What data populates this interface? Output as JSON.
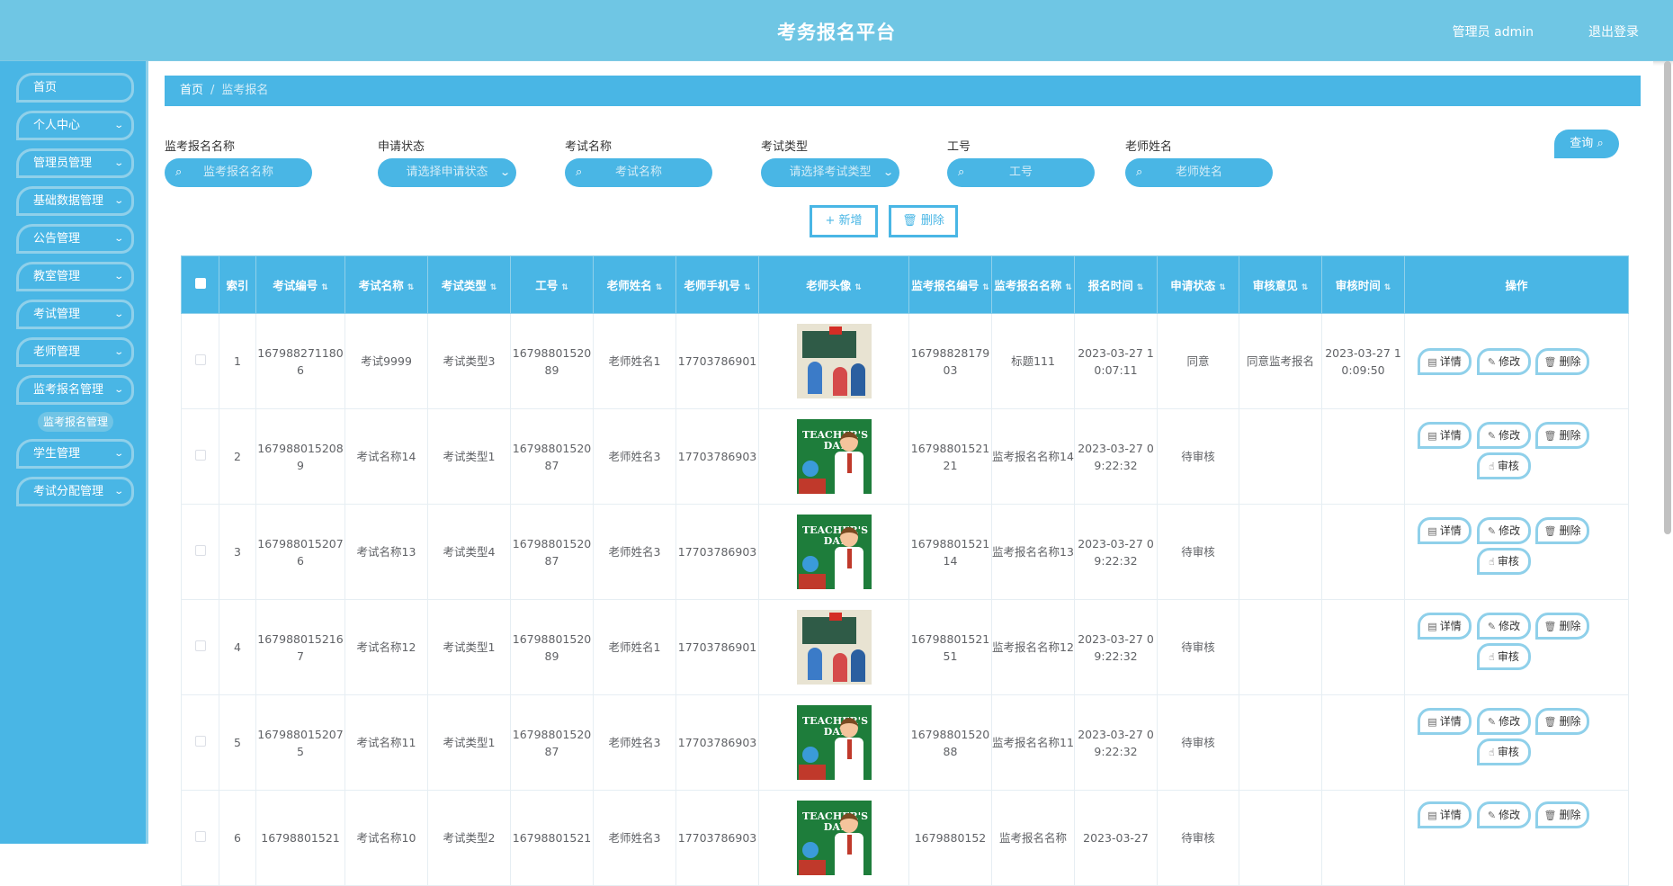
{
  "header": {
    "title": "考务报名平台",
    "user": "管理员 admin",
    "logout": "退出登录"
  },
  "sidebar": {
    "items": [
      {
        "label": "首页",
        "chevron": false
      },
      {
        "label": "个人中心",
        "chevron": true
      },
      {
        "label": "管理员管理",
        "chevron": true
      },
      {
        "label": "基础数据管理",
        "chevron": true
      },
      {
        "label": "公告管理",
        "chevron": true
      },
      {
        "label": "教室管理",
        "chevron": true
      },
      {
        "label": "考试管理",
        "chevron": true
      },
      {
        "label": "老师管理",
        "chevron": true
      },
      {
        "label": "监考报名管理",
        "chevron": true
      }
    ],
    "active_sub": "监考报名管理",
    "items_after": [
      {
        "label": "学生管理"
      },
      {
        "label": "考试分配管理"
      }
    ]
  },
  "breadcrumb": {
    "home": "首页",
    "sep": "/",
    "current": "监考报名"
  },
  "filters": [
    {
      "label": "监考报名名称",
      "placeholder": "监考报名名称"
    },
    {
      "label": "申请状态",
      "placeholder": "请选择申请状态"
    },
    {
      "label": "考试名称",
      "placeholder": "考试名称"
    },
    {
      "label": "考试类型",
      "placeholder": "请选择考试类型"
    },
    {
      "label": "工号",
      "placeholder": "工号"
    },
    {
      "label": "老师姓名",
      "placeholder": "老师姓名"
    }
  ],
  "query_btn": "查询",
  "add_btn": "+ 新增",
  "del_btn": "删除",
  "table": {
    "headers": [
      "索引",
      "考试编号",
      "考试名称",
      "考试类型",
      "工号",
      "老师姓名",
      "老师手机号",
      "老师头像",
      "监考报名编号",
      "监考报名名称",
      "报名时间",
      "申请状态",
      "审核意见",
      "审核时间",
      "操作"
    ],
    "rows": [
      {
        "idx": "1",
        "exam_no": "1679882711806",
        "exam_name": "考试9999",
        "exam_type": "考试类型3",
        "job_no": "1679880152089",
        "teacher": "老师姓名1",
        "phone": "17703786901",
        "avatar": "classroom",
        "reg_no": "1679882817903",
        "reg_name": "标题111",
        "reg_time": "2023-03-27 10:07:11",
        "status": "同意",
        "opinion": "同意监考报名",
        "audit_time": "2023-03-27 10:09:50"
      },
      {
        "idx": "2",
        "exam_no": "1679880152089",
        "exam_name": "考试名称14",
        "exam_type": "考试类型1",
        "job_no": "1679880152087",
        "teacher": "老师姓名3",
        "phone": "17703786903",
        "avatar": "teacher",
        "reg_no": "1679880152121",
        "reg_name": "监考报名名称14",
        "reg_time": "2023-03-27 09:22:32",
        "status": "待审核",
        "opinion": "",
        "audit_time": ""
      },
      {
        "idx": "3",
        "exam_no": "1679880152076",
        "exam_name": "考试名称13",
        "exam_type": "考试类型4",
        "job_no": "1679880152087",
        "teacher": "老师姓名3",
        "phone": "17703786903",
        "avatar": "teacher",
        "reg_no": "1679880152114",
        "reg_name": "监考报名名称13",
        "reg_time": "2023-03-27 09:22:32",
        "status": "待审核",
        "opinion": "",
        "audit_time": ""
      },
      {
        "idx": "4",
        "exam_no": "1679880152167",
        "exam_name": "考试名称12",
        "exam_type": "考试类型1",
        "job_no": "1679880152089",
        "teacher": "老师姓名1",
        "phone": "17703786901",
        "avatar": "classroom",
        "reg_no": "1679880152151",
        "reg_name": "监考报名名称12",
        "reg_time": "2023-03-27 09:22:32",
        "status": "待审核",
        "opinion": "",
        "audit_time": ""
      },
      {
        "idx": "5",
        "exam_no": "1679880152075",
        "exam_name": "考试名称11",
        "exam_type": "考试类型1",
        "job_no": "1679880152087",
        "teacher": "老师姓名3",
        "phone": "17703786903",
        "avatar": "teacher",
        "reg_no": "1679880152088",
        "reg_name": "监考报名名称11",
        "reg_time": "2023-03-27 09:22:32",
        "status": "待审核",
        "opinion": "",
        "audit_time": ""
      },
      {
        "idx": "6",
        "exam_no": "16798801521",
        "exam_name": "考试名称10",
        "exam_type": "考试类型2",
        "job_no": "16798801521",
        "teacher": "老师姓名3",
        "phone": "17703786903",
        "avatar": "teacher",
        "reg_no": "1679880152",
        "reg_name": "监考报名名称",
        "reg_time": "2023-03-27",
        "status": "待审核",
        "opinion": "",
        "audit_time": ""
      }
    ]
  },
  "ops": {
    "detail": "详情",
    "edit": "修改",
    "delete": "删除",
    "audit": "审核"
  },
  "avatar_text": "TEACHER'S DAY",
  "colors": {
    "header": "#6fc6e4",
    "primary": "#49b6e5",
    "border_light": "#8fd0ea"
  }
}
